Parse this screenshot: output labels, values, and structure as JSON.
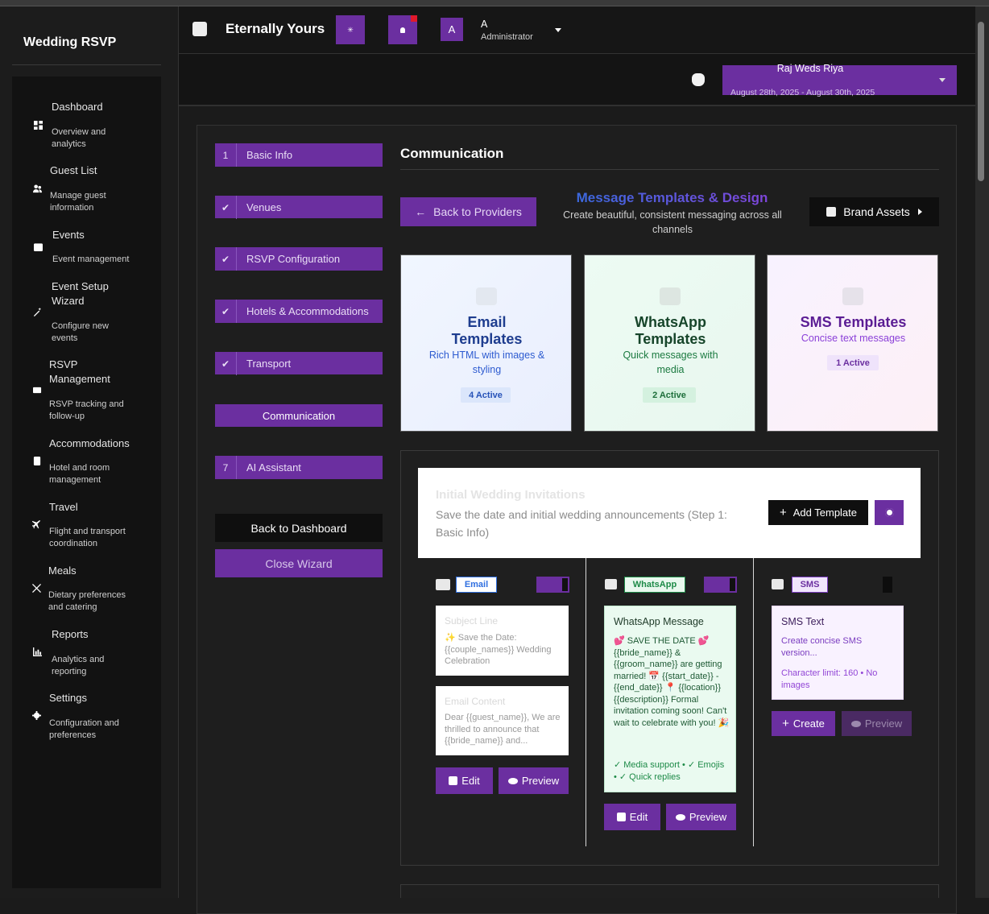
{
  "sidebar": {
    "brand": "Wedding RSVP",
    "items": [
      {
        "title": "Dashboard",
        "sub": "Overview and analytics"
      },
      {
        "title": "Guest List",
        "sub": "Manage guest information"
      },
      {
        "title": "Events",
        "sub": "Event management"
      },
      {
        "title": "Event Setup Wizard",
        "sub": "Configure new events"
      },
      {
        "title": "RSVP Management",
        "sub": "RSVP tracking and follow-up"
      },
      {
        "title": "Accommodations",
        "sub": "Hotel and room management"
      },
      {
        "title": "Travel",
        "sub": "Flight and transport coordination"
      },
      {
        "title": "Meals",
        "sub": "Dietary preferences and catering"
      },
      {
        "title": "Reports",
        "sub": "Analytics and reporting"
      },
      {
        "title": "Settings",
        "sub": "Configuration and preferences"
      }
    ]
  },
  "header": {
    "app_title": "Eternally Yours",
    "avatar_letter": "A",
    "user_name": "A",
    "user_role": "Administrator",
    "event_name": "Raj Weds Riya",
    "event_dates": "August 28th, 2025 - August 30th, 2025"
  },
  "wizard": {
    "steps": [
      {
        "num": "1",
        "label": "Basic Info"
      },
      {
        "num": "✔",
        "label": "Venues"
      },
      {
        "num": "✔",
        "label": "RSVP Configuration"
      },
      {
        "num": "✔",
        "label": "Hotels & Accommodations"
      },
      {
        "num": "✔",
        "label": "Transport"
      },
      {
        "num": "",
        "label": "Communication"
      },
      {
        "num": "7",
        "label": "AI Assistant"
      }
    ],
    "back_dashboard": "Back to Dashboard",
    "close_wizard": "Close Wizard"
  },
  "main": {
    "section_title": "Communication",
    "back_providers": "Back to Providers",
    "templates_title": "Message Templates & Design",
    "templates_sub": "Create beautiful, consistent messaging across all channels",
    "brand_assets": "Brand Assets",
    "cards": [
      {
        "title": "Email Templates",
        "desc": "Rich HTML with images & styling",
        "badge": "4 Active"
      },
      {
        "title": "WhatsApp Templates",
        "desc": "Quick messages with media",
        "badge": "2 Active"
      },
      {
        "title": "SMS Templates",
        "desc": "Concise text messages",
        "badge": "1 Active"
      }
    ],
    "category": {
      "title": "Initial Wedding Invitations",
      "desc": "Save the date and initial wedding announcements (Step 1: Basic Info)",
      "add_template": "Add Template"
    },
    "email": {
      "tag": "Email",
      "subject_label": "Subject Line",
      "subject": "✨ Save the Date: {{couple_names}} Wedding Celebration",
      "content_label": "Email Content",
      "content": "Dear {{guest_name}}, We are thrilled to announce that {{bride_name}} and...",
      "edit": "Edit",
      "preview": "Preview"
    },
    "whatsapp": {
      "tag": "WhatsApp",
      "label": "WhatsApp Message",
      "message": "💕 SAVE THE DATE 💕 {{bride_name}} & {{groom_name}} are getting married! 📅 {{start_date}} - {{end_date}} 📍 {{location}} {{description}} Formal invitation coming soon! Can't wait to celebrate with you! 🎉",
      "features": "✓ Media support • ✓ Emojis • ✓ Quick replies",
      "edit": "Edit",
      "preview": "Preview"
    },
    "sms": {
      "tag": "SMS",
      "label": "SMS Text",
      "placeholder": "Create concise SMS version...",
      "limit": "Character limit: 160 • No images",
      "create": "Create",
      "preview": "Preview"
    }
  }
}
